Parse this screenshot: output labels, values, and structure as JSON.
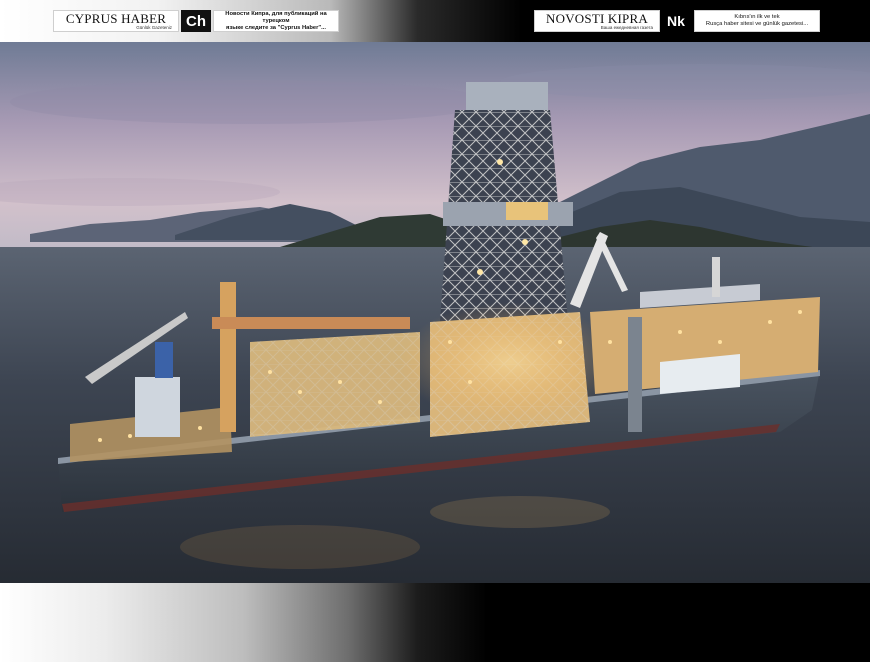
{
  "header": {
    "left_ad": {
      "logo_name": "CYPRUS HABER",
      "logo_tagline": "Günlük Gazeteniz",
      "badge": "Ch",
      "promo_line1": "Новости Кипра, для публикаций на турецком",
      "promo_line2": "языке следите за \"Cyprus Haber\"..."
    },
    "right_ad": {
      "logo_name": "NOVOSTI KIPRA",
      "logo_tagline": "Ваша ежедневная газета",
      "badge": "Nk",
      "promo_line1": "Kıbrıs'ın ilk ve tek",
      "promo_line2": "Rusça haber sitesi ve günlük gazetesi..."
    }
  },
  "photo": {
    "subject": "drillship-at-dusk"
  },
  "colors": {
    "sky_top": "#7e8aa3",
    "sky_glow": "#c9b7c8",
    "water": "#38404c",
    "hull": "#3d4652",
    "lights": "#ffd68a"
  }
}
